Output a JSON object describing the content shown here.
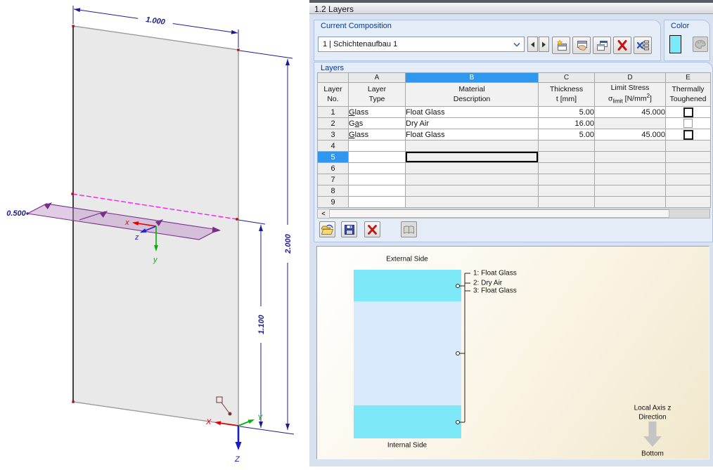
{
  "viewport3d": {
    "dim_width": "1.000",
    "dim_height": "2.000",
    "dim_cut_height": "1.100",
    "dim_depth": "0.500",
    "local_axes": {
      "x": "x",
      "y": "y",
      "z": "z"
    },
    "global_axes": {
      "x": "X",
      "y": "Y",
      "z": "Z"
    },
    "colors": {
      "panel": "#e9e9e9",
      "section_plane": "#bb8fc4",
      "section_outline": "#7b2d8b",
      "dimension": "#1c1c8f",
      "cut_line": "#ff1aff",
      "axis_x": "#e00000",
      "axis_y": "#00b400",
      "axis_z": "#1a1acc"
    }
  },
  "dialog": {
    "title": "1.2 Layers",
    "composition": {
      "group_label": "Current Composition",
      "value": "1 | Schichtenaufbau 1",
      "toolbar_icons": [
        "new",
        "rename",
        "copy",
        "delete",
        "delete-all"
      ]
    },
    "color_group": {
      "group_label": "Color",
      "swatch_color": "#7ce9f9"
    },
    "layers_group_label": "Layers",
    "accent_selection": "#2e97ee",
    "table": {
      "corner": [
        "Layer",
        "No."
      ],
      "letters": [
        "A",
        "B",
        "C",
        "D",
        "E"
      ],
      "selected_letter": "B",
      "selected_row": "5",
      "selected_col": "B",
      "headers": {
        "a": [
          "Layer",
          "Type"
        ],
        "b": [
          "Material",
          "Description"
        ],
        "c": [
          "Thickness",
          "t [mm]"
        ],
        "d": {
          "line1": "Limit Stress",
          "sym": "σ",
          "sub": "limit",
          "unit_pre": " [N/mm",
          "sup": "2",
          "unit_post": "]"
        },
        "e": [
          "Thermally",
          "Toughened"
        ]
      },
      "rows": [
        {
          "no": "1",
          "type": "Glass",
          "u": 0,
          "desc": "Float Glass",
          "t": "5.00",
          "limit": "45.000",
          "box": "normal"
        },
        {
          "no": "2",
          "type": "Gas",
          "u": 1,
          "desc": "Dry Air",
          "t": "16.00",
          "limit": "",
          "box": "disabled"
        },
        {
          "no": "3",
          "type": "Glass",
          "u": 0,
          "desc": "Float Glass",
          "t": "5.00",
          "limit": "45.000",
          "box": "normal"
        },
        {
          "no": "4"
        },
        {
          "no": "5"
        },
        {
          "no": "6"
        },
        {
          "no": "7"
        },
        {
          "no": "8"
        },
        {
          "no": "9"
        }
      ]
    },
    "bottom_toolbar_icons": [
      "open",
      "save",
      "delete",
      "library"
    ],
    "preview": {
      "external_label": "External Side",
      "internal_label": "Internal Side",
      "legend": [
        "1: Float Glass",
        "2: Dry Air",
        "3: Float Glass"
      ],
      "layer_colors": [
        "#7ce8f8",
        "#d9e9fc",
        "#7ce8f8"
      ],
      "local_axis_label_1": "Local Axis z",
      "local_axis_label_2": "Direction",
      "bottom_label": "Bottom"
    }
  }
}
